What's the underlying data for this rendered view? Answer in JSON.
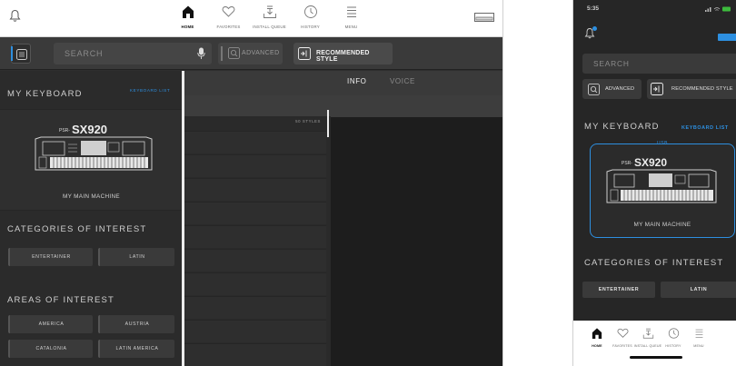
{
  "nav": {
    "items": [
      {
        "label": "HOME",
        "icon": "home-icon",
        "active": true
      },
      {
        "label": "FAVORITES",
        "icon": "heart-icon",
        "active": false
      },
      {
        "label": "INSTALL QUEUE",
        "icon": "install-queue-icon",
        "active": false
      },
      {
        "label": "HISTORY",
        "icon": "history-icon",
        "active": false
      },
      {
        "label": "MENU",
        "icon": "menu-icon",
        "active": false
      }
    ]
  },
  "toolbar": {
    "search_placeholder": "SEARCH",
    "advanced_label": "ADVANCED",
    "recommended_label": "RECOMMENDED STYLE"
  },
  "my_keyboard": {
    "title": "MY KEYBOARD",
    "list_link": "KEYBOARD LIST",
    "model_prefix": "PSR-",
    "model": "SX920",
    "machine_name": "MY MAIN MACHINE",
    "connection": "USB"
  },
  "categories": {
    "title": "CATEGORIES OF INTEREST",
    "items": [
      "ENTERTAINER",
      "LATIN"
    ]
  },
  "areas": {
    "title": "AREAS OF INTEREST",
    "items": [
      "AMERICA",
      "AUSTRIA",
      "CATALONIA",
      "LATIN AMERICA"
    ]
  },
  "styles": {
    "count_label": "50 STYLES"
  },
  "detail_tabs": {
    "items": [
      "INFO",
      "VOICE"
    ],
    "active": "INFO"
  },
  "phone": {
    "status_time": "5:35"
  },
  "colors": {
    "accent": "#2d8fe0",
    "panel": "#2e2e2e",
    "nav_bg": "#ffffff"
  }
}
